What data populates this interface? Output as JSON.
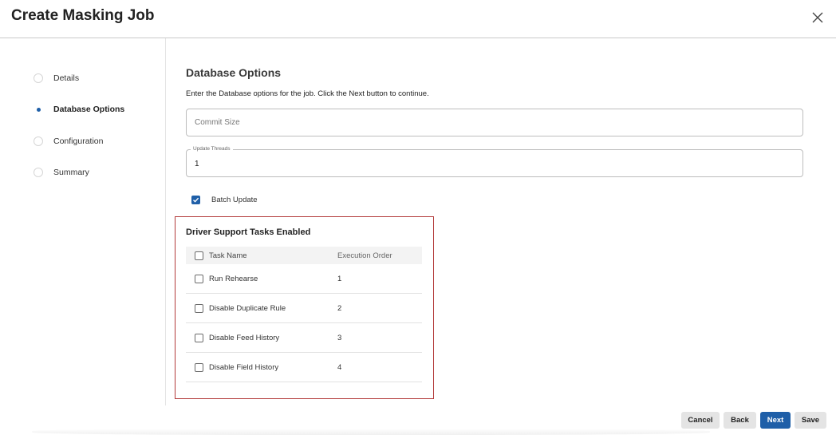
{
  "dialog": {
    "title": "Create Masking Job",
    "close_icon": "close-icon"
  },
  "steps": [
    {
      "label": "Details",
      "active": false
    },
    {
      "label": "Database Options",
      "active": true
    },
    {
      "label": "Configuration",
      "active": false
    },
    {
      "label": "Summary",
      "active": false
    }
  ],
  "section": {
    "title": "Database Options",
    "description": "Enter the Database options for the job. Click the Next button to continue."
  },
  "commit_size": {
    "placeholder": "Commit Size",
    "value": ""
  },
  "update_threads": {
    "label": "Update Threads",
    "value": "1"
  },
  "batch_update": {
    "label": "Batch Update",
    "checked": true
  },
  "driver_tasks": {
    "title": "Driver Support Tasks Enabled",
    "columns": [
      "Task Name",
      "Execution Order"
    ],
    "rows": [
      {
        "name": "Run Rehearse",
        "order": "1"
      },
      {
        "name": "Disable Duplicate Rule",
        "order": "2"
      },
      {
        "name": "Disable Feed History",
        "order": "3"
      },
      {
        "name": "Disable Field History",
        "order": "4"
      }
    ]
  },
  "buttons": {
    "cancel": "Cancel",
    "back": "Back",
    "next": "Next",
    "save": "Save"
  },
  "colors": {
    "primary": "#1f5fa8",
    "highlight_border": "#b33a3a"
  }
}
